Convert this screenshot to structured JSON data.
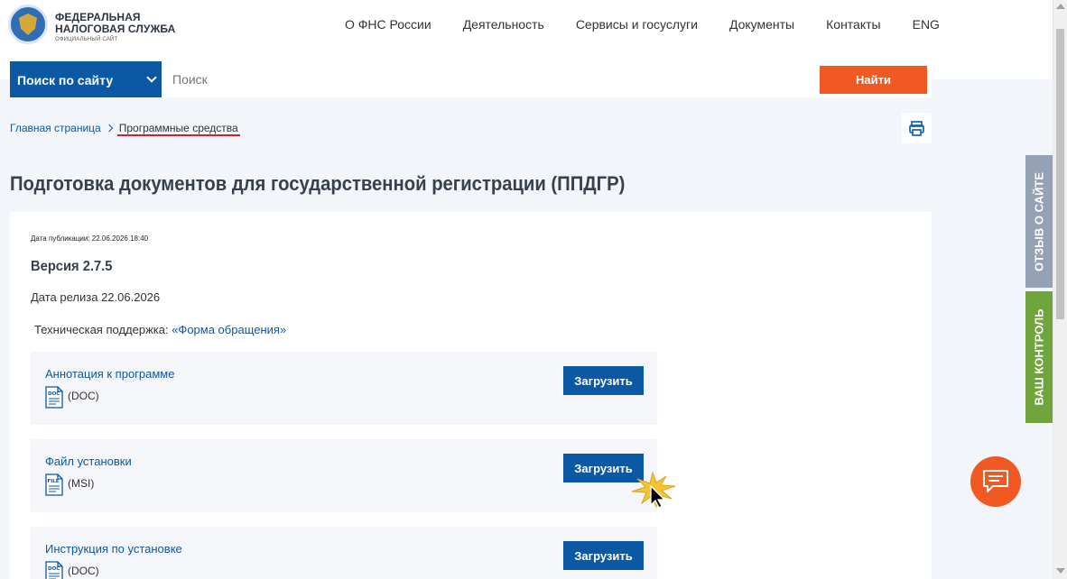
{
  "header": {
    "logo_line1": "ФЕДЕРАЛЬНАЯ",
    "logo_line2": "НАЛОГОВАЯ СЛУЖБА",
    "logo_line3": "ОФИЦИАЛЬНЫЙ САЙТ",
    "nav": [
      "О ФНС России",
      "Деятельность",
      "Сервисы и госуслуги",
      "Документы",
      "Контакты",
      "ENG"
    ]
  },
  "search": {
    "scope_label": "Поиск по сайту",
    "placeholder": "Поиск",
    "value": "",
    "button_label": "Найти"
  },
  "breadcrumb": {
    "home": "Главная страница",
    "current": "Программные средства"
  },
  "page": {
    "title": "Подготовка документов для государственной регистрации (ППДГР)",
    "publication_date": "Дата публикации: 22.06.2026 18:40",
    "version": "Версия 2.7.5",
    "release_date": "Дата релиза 22.06.2026",
    "support_prefix": "Техническая поддержка: ",
    "support_link": "«Форма обращения»"
  },
  "files": [
    {
      "title": "Аннотация к программе",
      "icon": "doc-file-icon",
      "icon_label": "DOC",
      "type": "(DOC)",
      "button": "Загрузить"
    },
    {
      "title": "Файл установки",
      "icon": "msi-file-icon",
      "icon_label": "FILE",
      "type": "(MSI)",
      "button": "Загрузить"
    },
    {
      "title": "Инструкция по установке",
      "icon": "doc-file-icon",
      "icon_label": "DOC",
      "type": "(DOC)",
      "button": "Загрузить"
    }
  ],
  "side_tabs": {
    "feedback": "ОТЗЫВ О САЙТЕ",
    "control": "ВАШ КОНТРОЛЬ"
  },
  "icons": {
    "print": "printer-icon",
    "chat": "chat-bubble-icon",
    "cursor": "mouse-cursor-icon"
  },
  "colors": {
    "brand_blue": "#0b58a4",
    "accent_orange": "#f05a22",
    "feedback_tab": "#95a2b5",
    "control_tab": "#6fa53c",
    "underline_red": "#d81e2a"
  }
}
